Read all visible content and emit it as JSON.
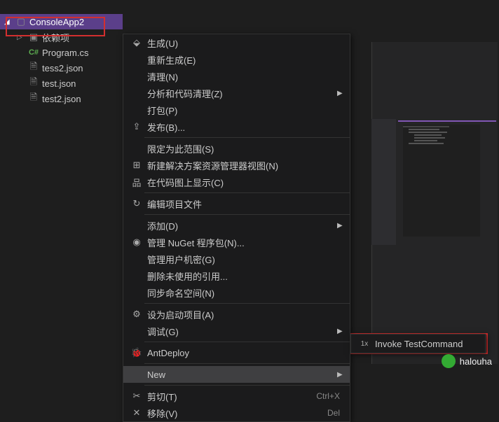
{
  "tree": {
    "project": "ConsoleApp2",
    "deps": "依赖项",
    "files": [
      "Program.cs",
      "tess2.json",
      "test.json",
      "test2.json"
    ]
  },
  "menu": {
    "build": "生成(U)",
    "rebuild": "重新生成(E)",
    "clean": "清理(N)",
    "analyze": "分析和代码清理(Z)",
    "pack": "打包(P)",
    "publish": "发布(B)...",
    "scope": "限定为此范围(S)",
    "newview": "新建解决方案资源管理器视图(N)",
    "codemap": "在代码图上显示(C)",
    "editproj": "编辑项目文件",
    "add": "添加(D)",
    "nuget": "管理 NuGet 程序包(N)...",
    "secrets": "管理用户机密(G)",
    "unused": "删除未使用的引用...",
    "syncns": "同步命名空间(N)",
    "startup": "设为启动项目(A)",
    "debug": "调试(G)",
    "antdeploy": "AntDeploy",
    "new": "New",
    "cut": "剪切(T)",
    "cut_sc": "Ctrl+X",
    "remove": "移除(V)",
    "remove_sc": "Del"
  },
  "submenu": {
    "invoke": "Invoke TestCommand"
  },
  "watermark": "halouha"
}
